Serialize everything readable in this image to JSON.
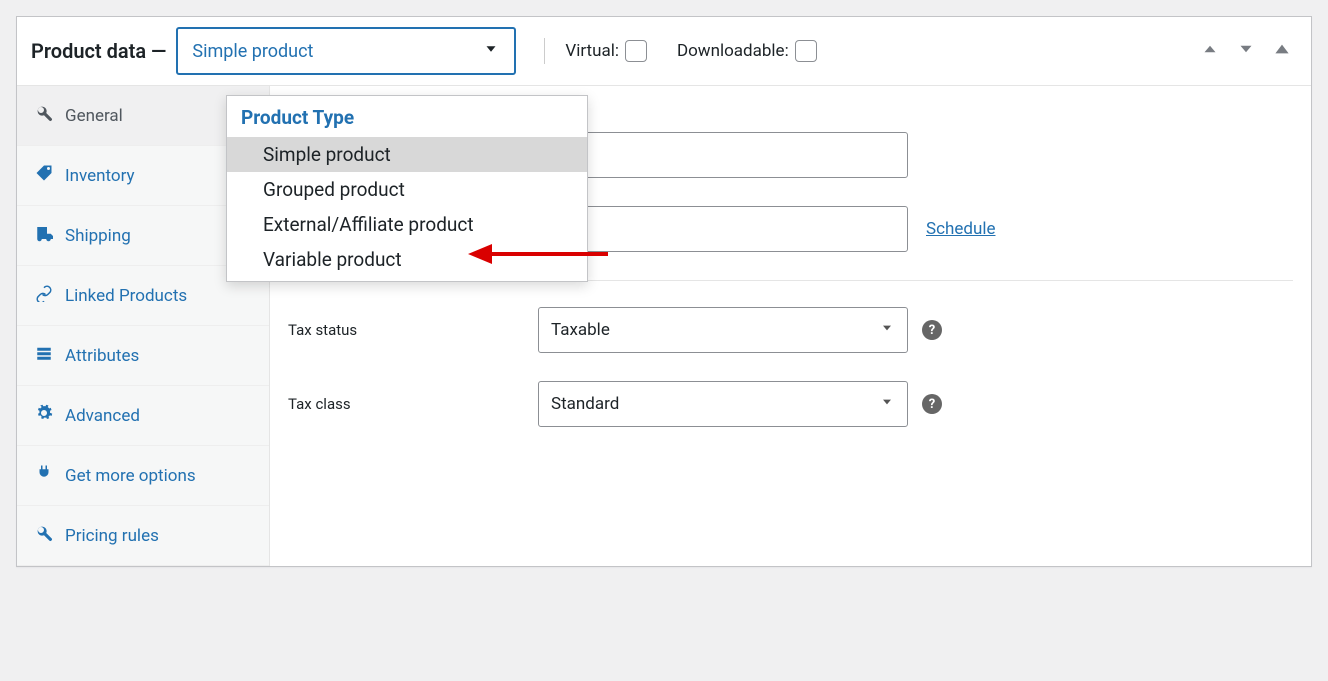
{
  "header": {
    "title": "Product data —",
    "selected_product_type": "Simple product",
    "virtual_label": "Virtual:",
    "downloadable_label": "Downloadable:"
  },
  "dropdown": {
    "group_label": "Product Type",
    "options": [
      "Simple product",
      "Grouped product",
      "External/Affiliate product",
      "Variable product"
    ],
    "selected_index": 0
  },
  "sidebar": {
    "items": [
      {
        "label": "General",
        "icon": "wrench-icon",
        "active": true
      },
      {
        "label": "Inventory",
        "icon": "tag-icon",
        "active": false
      },
      {
        "label": "Shipping",
        "icon": "truck-icon",
        "active": false
      },
      {
        "label": "Linked Products",
        "icon": "link-icon",
        "active": false
      },
      {
        "label": "Attributes",
        "icon": "list-icon",
        "active": false
      },
      {
        "label": "Advanced",
        "icon": "gear-icon",
        "active": false
      },
      {
        "label": "Get more options",
        "icon": "plug-icon",
        "active": false
      },
      {
        "label": "Pricing rules",
        "icon": "wrench-icon",
        "active": false
      }
    ]
  },
  "general": {
    "regular_price_label": "",
    "sale_price_label": "",
    "schedule_link": "Schedule",
    "tax_status_label": "Tax status",
    "tax_status_value": "Taxable",
    "tax_class_label": "Tax class",
    "tax_class_value": "Standard"
  },
  "colors": {
    "accent": "#2271b1",
    "annotation": "#d90000"
  }
}
